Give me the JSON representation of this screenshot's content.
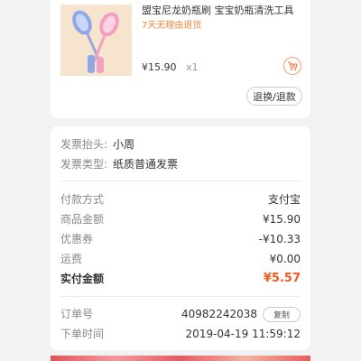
{
  "product": {
    "title": "盟宝尼龙奶瓶刷 宝宝奶瓶清洗工具",
    "tag": "7天无理由退货",
    "price": "¥15.90",
    "qty": "x1",
    "cart_icon": "cart-add-icon",
    "return_label": "退换/退款",
    "image_icon": "bottle-brush-image"
  },
  "invoice": {
    "header_label": "发票抬头:",
    "header_value": "小周",
    "type_label": "发票类型:",
    "type_value": "纸质普通发票"
  },
  "payment": {
    "method_label": "付款方式",
    "method_value": "支付宝",
    "amount_label": "商品金额",
    "amount_value": "¥15.90",
    "coupon_label": "优惠券",
    "coupon_value": "-¥10.33",
    "shipping_label": "运费",
    "shipping_value": "¥0.00",
    "total_label": "实付金额",
    "total_value": "¥5.57"
  },
  "order": {
    "number_label": "订单号",
    "number_value": "40982242038",
    "copy_label": "复制",
    "time_label": "下单时间",
    "time_value": "2019-04-19 11:59:12"
  },
  "colors": {
    "accent": "#f25a1c",
    "tag": "#f08a3c"
  }
}
